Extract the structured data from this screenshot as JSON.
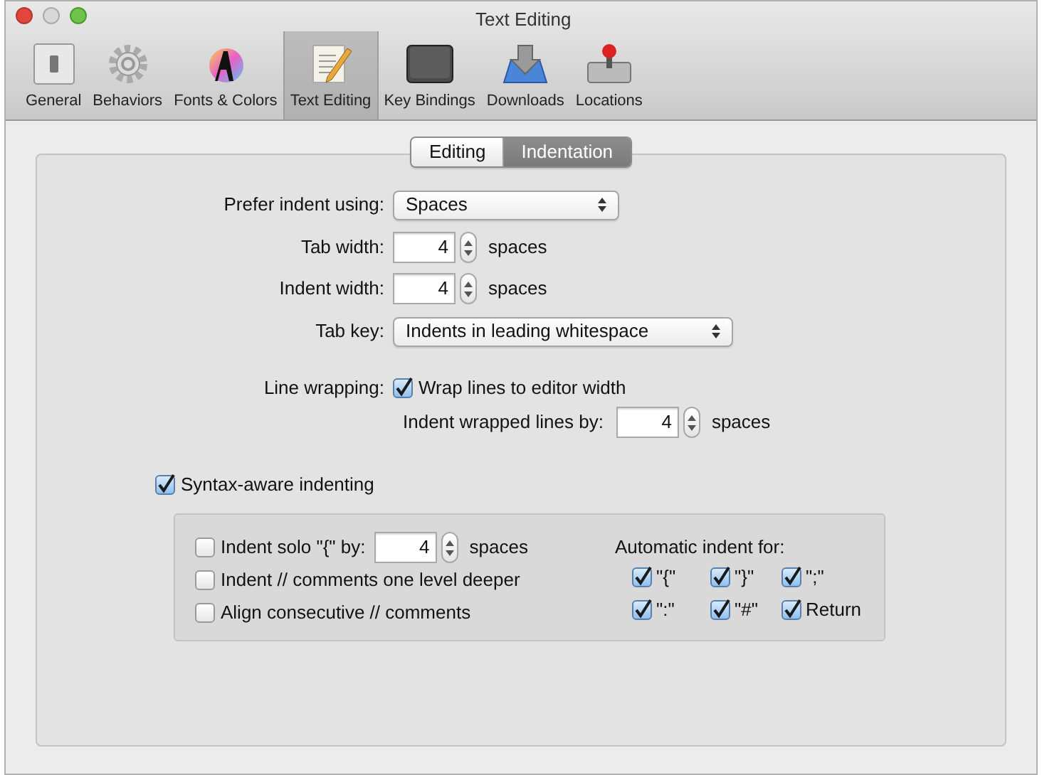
{
  "window": {
    "title": "Text Editing"
  },
  "toolbar": [
    {
      "label": "General",
      "selected": false
    },
    {
      "label": "Behaviors",
      "selected": false
    },
    {
      "label": "Fonts & Colors",
      "selected": false
    },
    {
      "label": "Text Editing",
      "selected": true
    },
    {
      "label": "Key Bindings",
      "selected": false
    },
    {
      "label": "Downloads",
      "selected": false
    },
    {
      "label": "Locations",
      "selected": false
    }
  ],
  "tabs": [
    {
      "label": "Editing",
      "selected": false
    },
    {
      "label": "Indentation",
      "selected": true
    }
  ],
  "prefer_indent": {
    "label": "Prefer indent using:",
    "value": "Spaces"
  },
  "tab_width": {
    "label": "Tab width:",
    "value": "4",
    "unit": "spaces"
  },
  "indent_width": {
    "label": "Indent width:",
    "value": "4",
    "unit": "spaces"
  },
  "tab_key": {
    "label": "Tab key:",
    "value": "Indents in leading whitespace"
  },
  "line_wrapping": {
    "label": "Line wrapping:",
    "checkbox": {
      "label": "Wrap lines to editor width",
      "checked": true
    },
    "indent_wrapped": {
      "label": "Indent wrapped lines by:",
      "value": "4",
      "unit": "spaces"
    }
  },
  "syntax_aware": {
    "label": "Syntax-aware indenting",
    "checked": true
  },
  "options": [
    {
      "kind": "field",
      "label": "Indent solo \"{\" by:",
      "checked": false,
      "value": "4",
      "unit": "spaces"
    },
    {
      "kind": "plain",
      "label": "Indent // comments one level deeper",
      "checked": false
    },
    {
      "kind": "plain",
      "label": "Align consecutive // comments",
      "checked": false
    }
  ],
  "automatic_indent": {
    "label": "Automatic indent for:",
    "items": [
      {
        "label": "\"{\"",
        "checked": true
      },
      {
        "label": "\"}\"",
        "checked": true
      },
      {
        "label": "\";\"",
        "checked": true
      },
      {
        "label": "\":\"",
        "checked": true
      },
      {
        "label": "\"#\"",
        "checked": true
      },
      {
        "label": "Return",
        "checked": true
      }
    ]
  }
}
